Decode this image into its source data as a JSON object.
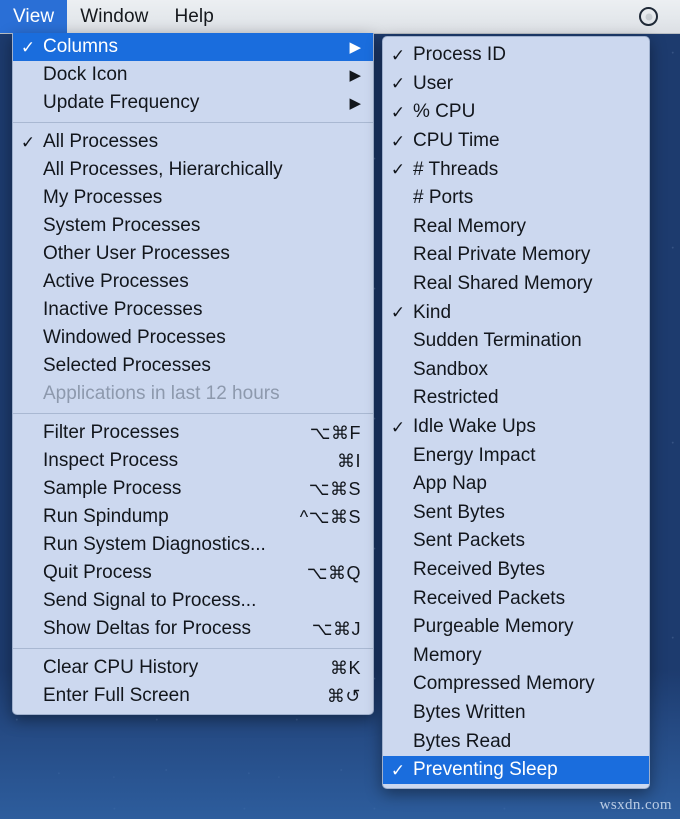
{
  "menubar": {
    "items": [
      {
        "label": "View",
        "active": true
      },
      {
        "label": "Window",
        "active": false
      },
      {
        "label": "Help",
        "active": false
      }
    ],
    "status_icon": "siri-circle-icon"
  },
  "view_menu": {
    "groups": [
      {
        "items": [
          {
            "label": "Columns",
            "checked": true,
            "submenu": true,
            "highlighted": true,
            "shortcut": ""
          },
          {
            "label": "Dock Icon",
            "checked": false,
            "submenu": true,
            "highlighted": false,
            "shortcut": ""
          },
          {
            "label": "Update Frequency",
            "checked": false,
            "submenu": true,
            "highlighted": false,
            "shortcut": ""
          }
        ]
      },
      {
        "items": [
          {
            "label": "All Processes",
            "checked": true,
            "shortcut": ""
          },
          {
            "label": "All Processes, Hierarchically",
            "checked": false,
            "shortcut": ""
          },
          {
            "label": "My Processes",
            "checked": false,
            "shortcut": ""
          },
          {
            "label": "System Processes",
            "checked": false,
            "shortcut": ""
          },
          {
            "label": "Other User Processes",
            "checked": false,
            "shortcut": ""
          },
          {
            "label": "Active Processes",
            "checked": false,
            "shortcut": ""
          },
          {
            "label": "Inactive Processes",
            "checked": false,
            "shortcut": ""
          },
          {
            "label": "Windowed Processes",
            "checked": false,
            "shortcut": ""
          },
          {
            "label": "Selected Processes",
            "checked": false,
            "shortcut": ""
          },
          {
            "label": "Applications in last 12 hours",
            "checked": false,
            "shortcut": "",
            "disabled": true
          }
        ]
      },
      {
        "items": [
          {
            "label": "Filter Processes",
            "checked": false,
            "shortcut": "⌥⌘F"
          },
          {
            "label": "Inspect Process",
            "checked": false,
            "shortcut": "⌘I"
          },
          {
            "label": "Sample Process",
            "checked": false,
            "shortcut": "⌥⌘S"
          },
          {
            "label": "Run Spindump",
            "checked": false,
            "shortcut": "^⌥⌘S"
          },
          {
            "label": "Run System Diagnostics...",
            "checked": false,
            "shortcut": ""
          },
          {
            "label": "Quit Process",
            "checked": false,
            "shortcut": "⌥⌘Q"
          },
          {
            "label": "Send Signal to Process...",
            "checked": false,
            "shortcut": ""
          },
          {
            "label": "Show Deltas for Process",
            "checked": false,
            "shortcut": "⌥⌘J"
          }
        ]
      },
      {
        "items": [
          {
            "label": "Clear CPU History",
            "checked": false,
            "shortcut": "⌘K"
          },
          {
            "label": "Enter Full Screen",
            "checked": false,
            "shortcut": "⌘↺"
          }
        ]
      }
    ]
  },
  "columns_submenu": {
    "items": [
      {
        "label": "Process ID",
        "checked": true,
        "highlighted": false
      },
      {
        "label": "User",
        "checked": true,
        "highlighted": false
      },
      {
        "label": "% CPU",
        "checked": true,
        "highlighted": false
      },
      {
        "label": "CPU Time",
        "checked": true,
        "highlighted": false
      },
      {
        "label": "# Threads",
        "checked": true,
        "highlighted": false
      },
      {
        "label": "# Ports",
        "checked": false,
        "highlighted": false
      },
      {
        "label": "Real Memory",
        "checked": false,
        "highlighted": false
      },
      {
        "label": "Real Private Memory",
        "checked": false,
        "highlighted": false
      },
      {
        "label": "Real Shared Memory",
        "checked": false,
        "highlighted": false
      },
      {
        "label": "Kind",
        "checked": true,
        "highlighted": false
      },
      {
        "label": "Sudden Termination",
        "checked": false,
        "highlighted": false
      },
      {
        "label": "Sandbox",
        "checked": false,
        "highlighted": false
      },
      {
        "label": "Restricted",
        "checked": false,
        "highlighted": false
      },
      {
        "label": "Idle Wake Ups",
        "checked": true,
        "highlighted": false
      },
      {
        "label": "Energy Impact",
        "checked": false,
        "highlighted": false
      },
      {
        "label": "App Nap",
        "checked": false,
        "highlighted": false
      },
      {
        "label": "Sent Bytes",
        "checked": false,
        "highlighted": false
      },
      {
        "label": "Sent Packets",
        "checked": false,
        "highlighted": false
      },
      {
        "label": "Received Bytes",
        "checked": false,
        "highlighted": false
      },
      {
        "label": "Received Packets",
        "checked": false,
        "highlighted": false
      },
      {
        "label": "Purgeable Memory",
        "checked": false,
        "highlighted": false
      },
      {
        "label": "Memory",
        "checked": false,
        "highlighted": false
      },
      {
        "label": "Compressed Memory",
        "checked": false,
        "highlighted": false
      },
      {
        "label": "Bytes Written",
        "checked": false,
        "highlighted": false
      },
      {
        "label": "Bytes Read",
        "checked": false,
        "highlighted": false
      },
      {
        "label": "Preventing Sleep",
        "checked": true,
        "highlighted": true
      }
    ]
  },
  "watermark": {
    "text": "wsxdn.com"
  },
  "glyphs": {
    "checkmark": "✓",
    "submenu_arrow": "▶"
  },
  "colors": {
    "highlight": "#1a6ddd",
    "menu_background": "#ccd8ef",
    "menubar_background": "#e7eaee",
    "disabled_text": "#8d99ad"
  }
}
